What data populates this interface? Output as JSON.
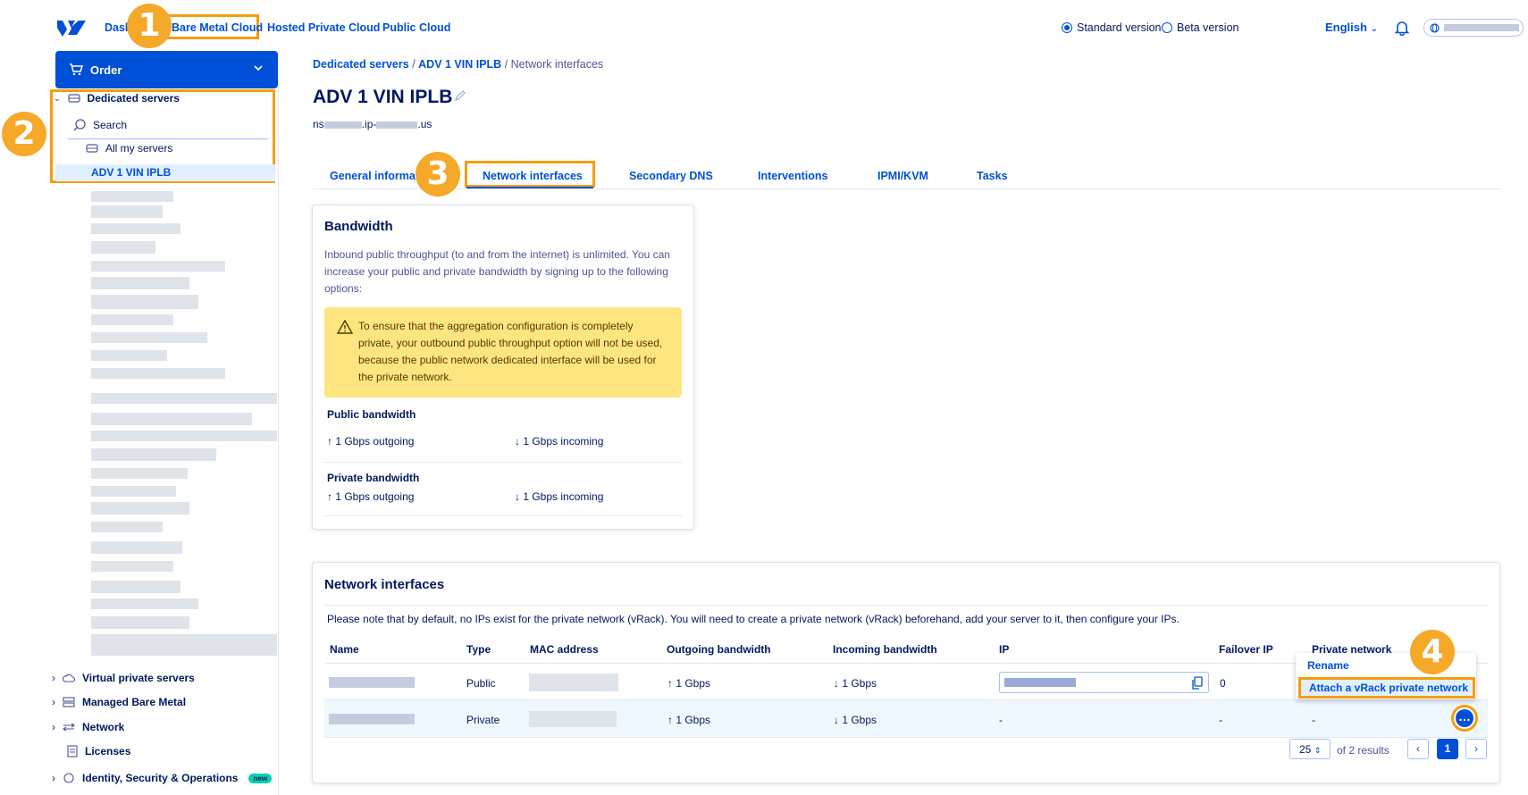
{
  "nav": {
    "dashboard": "Dashboard",
    "bare_metal": "Bare Metal Cloud",
    "hosted_private": "Hosted Private Cloud",
    "public_cloud": "Public Cloud",
    "standard_version": "Standard version",
    "beta_version": "Beta version",
    "language": "English"
  },
  "sidebar": {
    "order": "Order",
    "dedicated_servers": "Dedicated servers",
    "search": "Search",
    "all_my_servers": "All my servers",
    "active_server": "ADV 1 VIN IPLB",
    "sections": [
      {
        "label": "Virtual private servers"
      },
      {
        "label": "Managed Bare Metal"
      },
      {
        "label": "Network"
      },
      {
        "label": "Licenses"
      },
      {
        "label": "Identity, Security & Operations"
      }
    ],
    "new_tag": "new"
  },
  "breadcrumb": {
    "level1": "Dedicated servers",
    "level2": "ADV 1 VIN IPLB",
    "current": "Network interfaces"
  },
  "page": {
    "title": "ADV 1 VIN IPLB",
    "hostname_prefix": "ns",
    "hostname_mid": ".ip-",
    "hostname_suffix": ".us"
  },
  "tabs": [
    "General information",
    "Network interfaces",
    "Secondary DNS",
    "Interventions",
    "IPMI/KVM",
    "Tasks"
  ],
  "bandwidth": {
    "title": "Bandwidth",
    "intro": "Inbound public throughput (to and from the internet) is unlimited. You can increase your public and private bandwidth by signing up to the following options:",
    "warning": "To ensure that the aggregation configuration is completely private, your outbound public throughput option will not be used, because the public network dedicated interface will be used for the private network.",
    "public_label": "Public bandwidth",
    "public_out": "1 Gbps outgoing",
    "public_in": "1 Gbps incoming",
    "private_label": "Private bandwidth",
    "private_out": "1 Gbps outgoing",
    "private_in": "1 Gbps incoming"
  },
  "interfaces": {
    "title": "Network interfaces",
    "note": "Please note that by default, no IPs exist for the private network (vRack). You will need to create a private network (vRack) beforehand, add your server to it, then configure your IPs.",
    "columns": [
      "Name",
      "Type",
      "MAC address",
      "Outgoing bandwidth",
      "Incoming bandwidth",
      "IP",
      "Failover IP",
      "Private network"
    ],
    "rows": [
      {
        "type": "Public",
        "out": "1 Gbps",
        "in": "1 Gbps",
        "failover": "0",
        "private_net": ""
      },
      {
        "type": "Private",
        "out": "1 Gbps",
        "in": "1 Gbps",
        "ip": "-",
        "failover": "-",
        "private_net": "-"
      }
    ],
    "menu_rename": "Rename",
    "menu_attach": "Attach a vRack private network",
    "page_size": "25",
    "results": "of 2 results",
    "current_page": "1"
  },
  "steps": [
    "1",
    "2",
    "3",
    "4"
  ],
  "colors": {
    "accent": "#0050d7",
    "highlight": "#f59e0b",
    "warning_bg": "#ffe580",
    "badge": "#f6a829"
  }
}
